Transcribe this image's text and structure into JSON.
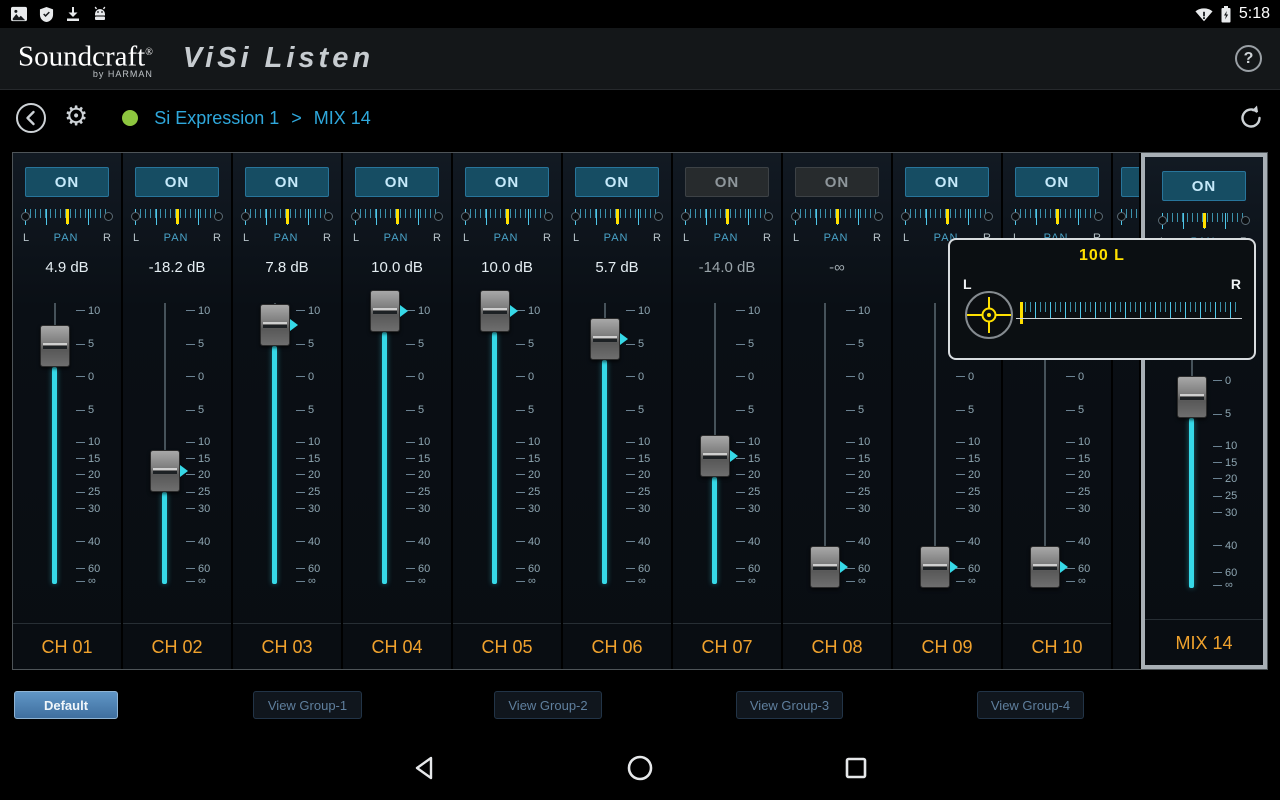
{
  "status_bar": {
    "time": "5:18",
    "left_icons": [
      "image-icon",
      "shield-icon",
      "download-icon",
      "android-icon"
    ],
    "right_icons": [
      "wifi-icon",
      "battery-icon"
    ]
  },
  "header": {
    "brand": "Soundcraft",
    "brand_reg": "®",
    "brand_sub": "by HARMAN",
    "app_title": "ViSi Listen",
    "help": "?"
  },
  "icons": {
    "settings_glyph": "⚙"
  },
  "breadcrumb": {
    "device": "Si Expression 1",
    "separator": ">",
    "target": "MIX 14",
    "status_color": "#8dc63f"
  },
  "pan_labels": {
    "left": "L",
    "center": "PAN",
    "right": "R"
  },
  "pan_popup": {
    "value": "100 L",
    "left_label": "L",
    "right_label": "R"
  },
  "fader_scale": [
    {
      "label": "10",
      "pos": 0.028
    },
    {
      "label": "5",
      "pos": 0.146
    },
    {
      "label": "0",
      "pos": 0.263
    },
    {
      "label": "5",
      "pos": 0.381
    },
    {
      "label": "10",
      "pos": 0.495
    },
    {
      "label": "15",
      "pos": 0.555
    },
    {
      "label": "20",
      "pos": 0.612
    },
    {
      "label": "25",
      "pos": 0.673
    },
    {
      "label": "30",
      "pos": 0.733
    },
    {
      "label": "40",
      "pos": 0.85
    },
    {
      "label": "60",
      "pos": 0.945
    },
    {
      "label": "∞",
      "pos": 0.99
    }
  ],
  "channels": [
    {
      "id": "CH 01",
      "on_label": "ON",
      "state": "on",
      "db": "4.9 dB",
      "fader": 0.153,
      "pan": 50,
      "arrow": false
    },
    {
      "id": "CH 02",
      "on_label": "ON",
      "state": "on",
      "db": "-18.2 dB",
      "fader": 0.598,
      "pan": 50,
      "arrow": true
    },
    {
      "id": "CH 03",
      "on_label": "ON",
      "state": "on",
      "db": "7.8 dB",
      "fader": 0.08,
      "pan": 50,
      "arrow": true
    },
    {
      "id": "CH 04",
      "on_label": "ON",
      "state": "on",
      "db": "10.0 dB",
      "fader": 0.028,
      "pan": 50,
      "arrow": true
    },
    {
      "id": "CH 05",
      "on_label": "ON",
      "state": "on",
      "db": "10.0 dB",
      "fader": 0.028,
      "pan": 50,
      "arrow": true
    },
    {
      "id": "CH 06",
      "on_label": "ON",
      "state": "on",
      "db": "5.7 dB",
      "fader": 0.128,
      "pan": 50,
      "arrow": true
    },
    {
      "id": "CH 07",
      "on_label": "ON",
      "state": "off",
      "db": "-14.0 dB",
      "fader": 0.544,
      "pan": 50,
      "arrow": true
    },
    {
      "id": "CH 08",
      "on_label": "ON",
      "state": "off",
      "db": "-∞",
      "fader": 0.94,
      "pan": 50,
      "arrow": true
    },
    {
      "id": "CH 09",
      "on_label": "ON",
      "state": "on",
      "db": "",
      "fader": 0.94,
      "pan": 50,
      "arrow": true
    },
    {
      "id": "CH 10",
      "on_label": "ON",
      "state": "on",
      "db": "",
      "fader": 0.94,
      "pan": 50,
      "arrow": true
    },
    {
      "id": "",
      "on_label": "ON",
      "state": "on",
      "partial": true
    },
    {
      "id": "MIX 14",
      "on_label": "ON",
      "state": "on",
      "db": "",
      "fader": 0.32,
      "pan": 50,
      "arrow": false,
      "selected": true
    }
  ],
  "footer": {
    "buttons": [
      {
        "label": "Default",
        "active": true
      },
      {
        "label": "View Group-1",
        "active": false
      },
      {
        "label": "View Group-2",
        "active": false
      },
      {
        "label": "View Group-3",
        "active": false
      },
      {
        "label": "View Group-4",
        "active": false
      }
    ]
  },
  "android_nav": [
    "back-icon",
    "home-icon",
    "recents-icon"
  ],
  "colors": {
    "accent_cyan": "#36d9e8",
    "pan_yellow": "#ffdf00",
    "channel_label_orange": "#f0a22d",
    "on_button_blue": "#164d63",
    "breadcrumb_blue": "#2fa8dc",
    "status_green": "#8dc63f",
    "default_button_blue": "#4d82b8"
  }
}
